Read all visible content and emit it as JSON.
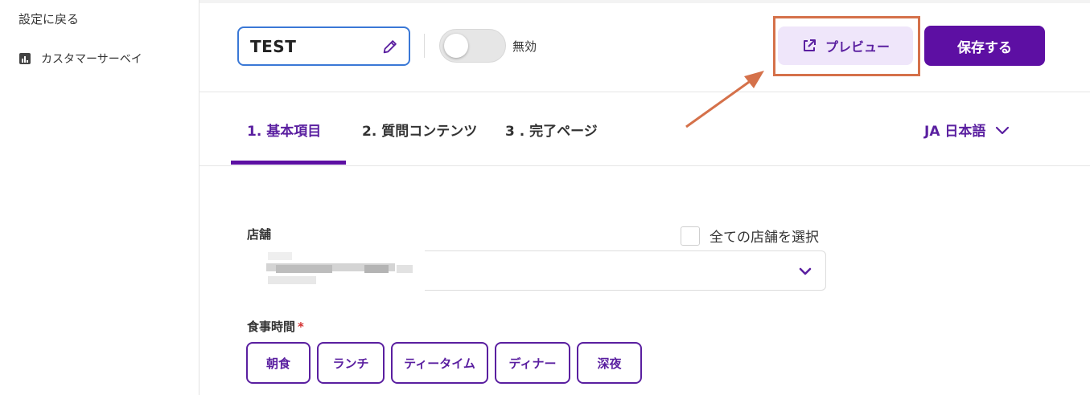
{
  "sidebar": {
    "back_label": "設定に戻る",
    "items": [
      {
        "label": "カスタマーサーベイ",
        "icon": "bar-chart-icon"
      }
    ]
  },
  "header": {
    "survey_title": "TEST",
    "toggle_label": "無効",
    "toggle_on": false,
    "preview_label": "プレビュー",
    "save_label": "保存する"
  },
  "tabs": [
    {
      "label": "1. 基本項目",
      "active": true
    },
    {
      "label": "2. 質問コンテンツ",
      "active": false
    },
    {
      "label": "3 . 完了ページ",
      "active": false
    }
  ],
  "language": {
    "label": "JA 日本語"
  },
  "form": {
    "store_label": "店舗",
    "select_all_label": "全ての店舗を選択",
    "meal_label": "食事時間",
    "required_mark": "*",
    "meal_options": [
      "朝食",
      "ランチ",
      "ティータイム",
      "ディナー",
      "深夜"
    ]
  },
  "colors": {
    "accent": "#5d0fa3",
    "accent_light": "#efe6fa",
    "highlight": "#d5714a",
    "title_border": "#3a78d6"
  }
}
